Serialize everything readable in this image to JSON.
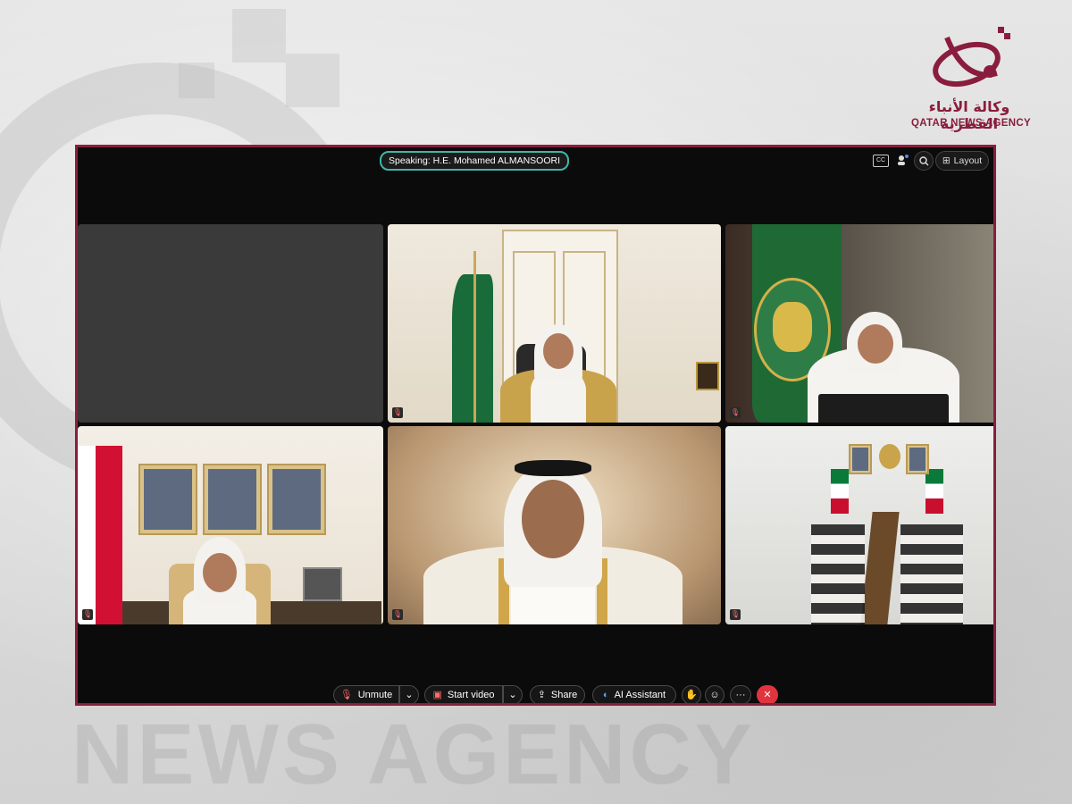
{
  "brand": {
    "arabic": "وكالة الأنباء القطرية",
    "english": "QATAR NEWS AGENCY",
    "color": "#8a1d3d"
  },
  "meeting": {
    "speaking": "Speaking: H.E. Mohamed ALMANSOORI",
    "layout_label": "Layout"
  },
  "top_controls": [
    {
      "icon": "closed-captions-icon"
    },
    {
      "icon": "participants-icon"
    },
    {
      "icon": "zoom-icon"
    },
    {
      "icon": "layout-icon",
      "label": "Layout"
    }
  ],
  "toolbar": {
    "unmute": "Unmute",
    "start_video": "Start video",
    "share": "Share",
    "ai_assistant": "AI Assistant",
    "more": "···",
    "end_icon": "✕"
  },
  "colors": {
    "accent_border": "#8a1d3d",
    "speaking_border": "#3fb7a6",
    "end_call": "#e0343f"
  }
}
